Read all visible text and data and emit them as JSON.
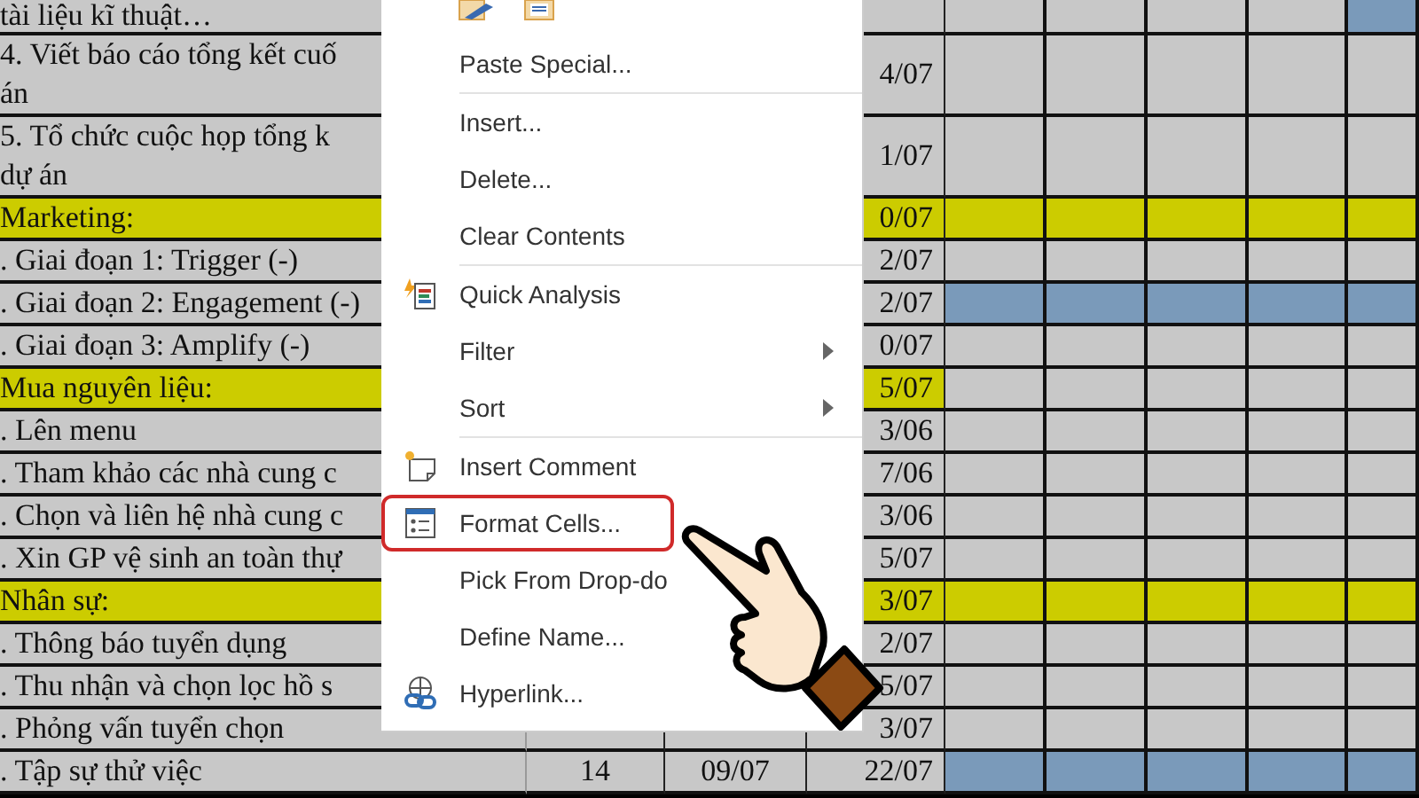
{
  "sheet": {
    "rows": [
      {
        "kind": "task",
        "name": "tài liệu kĩ thuật…",
        "timeline": [
          {
            "color": "#c8c8c8"
          },
          {
            "color": "#c8c8c8"
          },
          {
            "color": "#c8c8c8"
          },
          {
            "color": "#c8c8c8"
          },
          {
            "color": "#7a9aba"
          }
        ]
      },
      {
        "kind": "tall",
        "name": "4. Viết báo cáo tổng kết cuố\nán",
        "end": "4/07",
        "timeline": [
          {
            "color": "#c8c8c8"
          },
          {
            "color": "#c8c8c8"
          },
          {
            "color": "#c8c8c8"
          },
          {
            "color": "#c8c8c8"
          },
          {
            "color": "#c8c8c8"
          }
        ]
      },
      {
        "kind": "tall",
        "name": "5. Tổ chức cuộc họp tổng k\ndự án",
        "end": "1/07",
        "timeline": [
          {
            "color": "#c8c8c8"
          },
          {
            "color": "#c8c8c8"
          },
          {
            "color": "#c8c8c8"
          },
          {
            "color": "#c8c8c8"
          },
          {
            "color": "#c8c8c8"
          }
        ]
      },
      {
        "kind": "group",
        "name": "Marketing:",
        "end": "0/07",
        "timeline": [
          {
            "color": "#cccc00"
          },
          {
            "color": "#cccc00"
          },
          {
            "color": "#cccc00"
          },
          {
            "color": "#cccc00"
          },
          {
            "color": "#cccc00"
          }
        ]
      },
      {
        "kind": "task",
        "name": ". Giai đoạn 1: Trigger (-)",
        "end": "2/07",
        "timeline": [
          {
            "color": "#c8c8c8"
          },
          {
            "color": "#c8c8c8"
          },
          {
            "color": "#c8c8c8"
          },
          {
            "color": "#c8c8c8"
          },
          {
            "color": "#c8c8c8"
          }
        ]
      },
      {
        "kind": "task",
        "name": ". Giai đoạn 2: Engagement (-)",
        "end": "2/07",
        "timeline": [
          {
            "color": "#7a9aba"
          },
          {
            "color": "#7a9aba"
          },
          {
            "color": "#7a9aba"
          },
          {
            "color": "#7a9aba"
          },
          {
            "color": "#7a9aba"
          }
        ]
      },
      {
        "kind": "task",
        "name": ". Giai đoạn 3: Amplify (-)",
        "end": "0/07",
        "timeline": [
          {
            "color": "#c8c8c8"
          },
          {
            "color": "#c8c8c8"
          },
          {
            "color": "#c8c8c8"
          },
          {
            "color": "#c8c8c8"
          },
          {
            "color": "#c8c8c8"
          }
        ]
      },
      {
        "kind": "group",
        "name": "Mua nguyên liệu:",
        "end": "5/07",
        "timeline": [
          {
            "color": "#c8c8c8"
          },
          {
            "color": "#c8c8c8"
          },
          {
            "color": "#c8c8c8"
          },
          {
            "color": "#c8c8c8"
          },
          {
            "color": "#c8c8c8"
          }
        ]
      },
      {
        "kind": "task",
        "name": ". Lên menu",
        "end": "3/06",
        "timeline": [
          {
            "color": "#c8c8c8"
          },
          {
            "color": "#c8c8c8"
          },
          {
            "color": "#c8c8c8"
          },
          {
            "color": "#c8c8c8"
          },
          {
            "color": "#c8c8c8"
          }
        ]
      },
      {
        "kind": "task",
        "name": ". Tham khảo các nhà cung c",
        "end": "7/06",
        "timeline": [
          {
            "color": "#c8c8c8"
          },
          {
            "color": "#c8c8c8"
          },
          {
            "color": "#c8c8c8"
          },
          {
            "color": "#c8c8c8"
          },
          {
            "color": "#c8c8c8"
          }
        ]
      },
      {
        "kind": "task",
        "name": ". Chọn và liên hệ nhà cung c",
        "end": "3/06",
        "timeline": [
          {
            "color": "#c8c8c8"
          },
          {
            "color": "#c8c8c8"
          },
          {
            "color": "#c8c8c8"
          },
          {
            "color": "#c8c8c8"
          },
          {
            "color": "#c8c8c8"
          }
        ]
      },
      {
        "kind": "task",
        "name": ". Xin GP vệ sinh an toàn thự",
        "end": "5/07",
        "timeline": [
          {
            "color": "#c8c8c8"
          },
          {
            "color": "#c8c8c8"
          },
          {
            "color": "#c8c8c8"
          },
          {
            "color": "#c8c8c8"
          },
          {
            "color": "#c8c8c8"
          }
        ]
      },
      {
        "kind": "group",
        "name": "Nhân sự:",
        "end": "3/07",
        "timeline": [
          {
            "color": "#cccc00"
          },
          {
            "color": "#cccc00"
          },
          {
            "color": "#cccc00"
          },
          {
            "color": "#cccc00"
          },
          {
            "color": "#cccc00"
          }
        ]
      },
      {
        "kind": "task",
        "name": ". Thông báo tuyển dụng",
        "end": "2/07",
        "timeline": [
          {
            "color": "#c8c8c8"
          },
          {
            "color": "#c8c8c8"
          },
          {
            "color": "#c8c8c8"
          },
          {
            "color": "#c8c8c8"
          },
          {
            "color": "#c8c8c8"
          }
        ]
      },
      {
        "kind": "task",
        "name": ". Thu nhận và chọn lọc hồ s",
        "end": "5/07",
        "timeline": [
          {
            "color": "#c8c8c8"
          },
          {
            "color": "#c8c8c8"
          },
          {
            "color": "#c8c8c8"
          },
          {
            "color": "#c8c8c8"
          },
          {
            "color": "#c8c8c8"
          }
        ]
      },
      {
        "kind": "task",
        "name": ". Phỏng vấn tuyển chọn",
        "end": "3/07",
        "timeline": [
          {
            "color": "#c8c8c8"
          },
          {
            "color": "#c8c8c8"
          },
          {
            "color": "#c8c8c8"
          },
          {
            "color": "#c8c8c8"
          },
          {
            "color": "#c8c8c8"
          }
        ]
      },
      {
        "kind": "task",
        "name": ". Tập sự thử việc",
        "duration": "14",
        "start": "09/07",
        "end": "22/07",
        "timeline": [
          {
            "color": "#7a9aba"
          },
          {
            "color": "#7a9aba"
          },
          {
            "color": "#7a9aba"
          },
          {
            "color": "#7a9aba"
          },
          {
            "color": "#7a9aba"
          }
        ]
      }
    ]
  },
  "context_menu": {
    "items": [
      {
        "kind": "item",
        "label": "Paste Special...",
        "highlighted": false
      },
      {
        "kind": "separator"
      },
      {
        "kind": "item",
        "label": "Insert...",
        "highlighted": false
      },
      {
        "kind": "item",
        "label": "Delete...",
        "highlighted": false
      },
      {
        "kind": "item",
        "label": "Clear Contents",
        "highlighted": false
      },
      {
        "kind": "separator"
      },
      {
        "kind": "analysis",
        "label": "Quick Analysis",
        "highlighted": false
      },
      {
        "kind": "submenu",
        "label": "Filter",
        "highlighted": false
      },
      {
        "kind": "submenu",
        "label": "Sort",
        "highlighted": false
      },
      {
        "kind": "separator"
      },
      {
        "kind": "comment",
        "label": "Insert Comment",
        "highlighted": false
      },
      {
        "kind": "format",
        "label": "Format Cells...",
        "highlighted": true
      },
      {
        "kind": "item",
        "label": "Pick From Drop-do",
        "highlighted": false
      },
      {
        "kind": "item",
        "label": "Define Name...",
        "highlighted": false
      },
      {
        "kind": "link",
        "label": "Hyperlink...",
        "highlighted": false
      }
    ]
  }
}
